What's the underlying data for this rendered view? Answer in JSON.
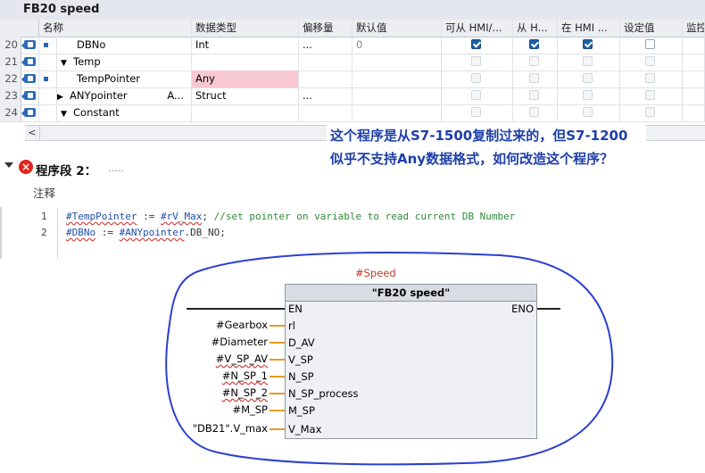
{
  "block_title": "FB20 speed",
  "table": {
    "headers": [
      "名称",
      "数据类型",
      "偏移量",
      "默认值",
      "可从 HMI/...",
      "从 H...",
      "在 HMI ...",
      "设定值",
      "监控"
    ],
    "rows": [
      {
        "num": "20",
        "name": "DBNo",
        "type": "Int",
        "offset": "...",
        "default": "0",
        "hmi1": true,
        "hmi2": true,
        "hmi3": true,
        "setv": false,
        "icon": "io-icon",
        "expander": ""
      },
      {
        "num": "21",
        "name": "Temp",
        "type": "",
        "offset": "",
        "default": "",
        "hmi1": false,
        "hmi2": false,
        "hmi3": false,
        "setv": false,
        "icon": "io-icon",
        "expander": "▼"
      },
      {
        "num": "22",
        "name": "TempPointer",
        "type": "Any",
        "offset": "",
        "default": "",
        "hmi1": false,
        "hmi2": false,
        "hmi3": false,
        "setv": false,
        "icon": "io-icon",
        "expander": ""
      },
      {
        "num": "23",
        "name": "ANYpointer",
        "type": "Struct",
        "offset": "...",
        "default": "",
        "hmi1": false,
        "hmi2": false,
        "hmi3": false,
        "setv": false,
        "icon": "io-icon",
        "expander": "▶",
        "suffix": "A..."
      },
      {
        "num": "24",
        "name": "Constant",
        "type": "",
        "offset": "",
        "default": "",
        "hmi1": false,
        "hmi2": false,
        "hmi3": false,
        "setv": false,
        "icon": "io-icon",
        "expander": "▼"
      }
    ],
    "scroll_left": "<"
  },
  "question": {
    "line1": "这个程序是从S7-1500复制过来的，但S7-1200",
    "line2": "似乎不支持Any数据格式，如何改造这个程序？"
  },
  "network": {
    "toggle": "▼",
    "error_icon": "×",
    "title": "程序段 2：",
    "title_dots": ".....",
    "comment": "注释",
    "code": [
      {
        "ln": "1",
        "var1": "#TempPointer",
        "op": " := ",
        "var2": "#rV_Max",
        "rest": "; ",
        "comment": "//set pointer on variable to read current DB Number"
      },
      {
        "ln": "2",
        "var1": "#DBNo",
        "op": " := ",
        "var2": "#ANYpointer",
        "rest": ".DB_NO;",
        "comment": ""
      }
    ]
  },
  "fbd": {
    "instance": "#Speed",
    "block_name": "\"FB20 speed\"",
    "en": "EN",
    "eno": "ENO",
    "inputs": [
      {
        "pin": "rl",
        "arg": "#Gearbox"
      },
      {
        "pin": "D_AV",
        "arg": "#Diameter"
      },
      {
        "pin": "V_SP",
        "arg": "#V_SP_AV"
      },
      {
        "pin": "N_SP",
        "arg": "#N_SP_1"
      },
      {
        "pin": "N_SP_process",
        "arg": "#N_SP_2"
      },
      {
        "pin": "M_SP",
        "arg": "#M_SP"
      },
      {
        "pin": "V_Max",
        "arg": "\"DB21\".V_max"
      }
    ]
  },
  "colors": {
    "accent_blue": "#1e3ea8",
    "error_red": "#e0241b",
    "instance_red": "#c0392b",
    "wire_orange": "#e89a22",
    "any_highlight": "#f8c8d2",
    "ellipse": "#2b3fd0"
  }
}
